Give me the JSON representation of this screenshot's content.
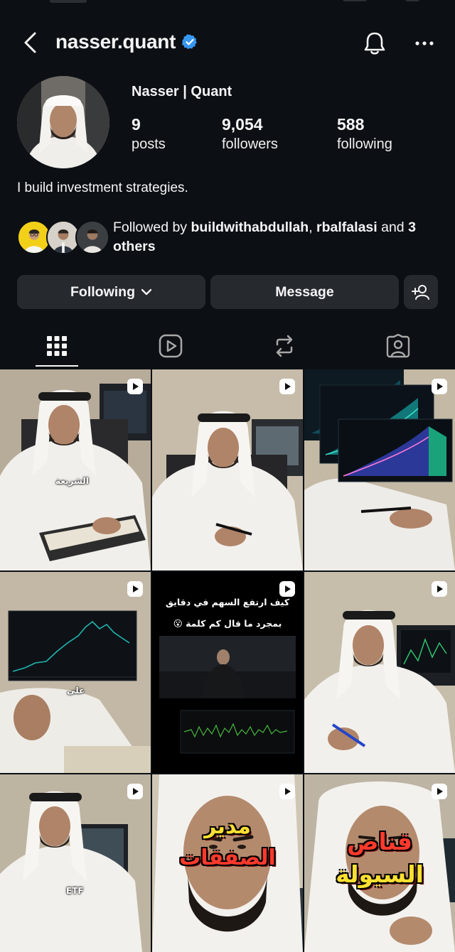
{
  "profile": {
    "username": "nasser.quant",
    "verified": true,
    "display_name": "Nasser | Quant",
    "bio": "I build investment strategies."
  },
  "stats": {
    "posts": {
      "value": "9",
      "label": "posts"
    },
    "followers": {
      "value": "9,054",
      "label": "followers"
    },
    "following": {
      "value": "588",
      "label": "following"
    }
  },
  "followed_by": {
    "prefix": "Followed by ",
    "users": [
      "buildwithabdullah",
      "rbalfalasi"
    ],
    "separator": ", ",
    "conjunction": " and",
    "others": "3 others"
  },
  "actions": {
    "following_label": "Following",
    "message_label": "Message"
  },
  "tabs": [
    {
      "name": "grid",
      "icon": "grid-icon",
      "active": true
    },
    {
      "name": "reels",
      "icon": "reels-icon",
      "active": false
    },
    {
      "name": "reposts",
      "icon": "repost-icon",
      "active": false
    },
    {
      "name": "tagged",
      "icon": "tagged-icon",
      "active": false
    }
  ],
  "posts": [
    {
      "type": "reel",
      "caption": "الشريعة"
    },
    {
      "type": "reel",
      "caption": ""
    },
    {
      "type": "reel",
      "caption": ""
    },
    {
      "type": "reel",
      "caption": "على"
    },
    {
      "type": "reel",
      "caption_lines": [
        "كيف ارتفع السهم في دقايق",
        "بمجرد ما قال كم كلمة 😮"
      ]
    },
    {
      "type": "reel",
      "caption": ""
    },
    {
      "type": "reel",
      "caption": "ETF"
    },
    {
      "type": "reel",
      "caption_lines": [
        "مدير",
        "الصفقات"
      ]
    },
    {
      "type": "reel",
      "caption_lines": [
        "قناص",
        "السيولة"
      ]
    }
  ],
  "colors": {
    "background": "#0c1014",
    "button": "#262a2f",
    "verified_blue": "#3897f0",
    "text": "#f5f5f5"
  }
}
